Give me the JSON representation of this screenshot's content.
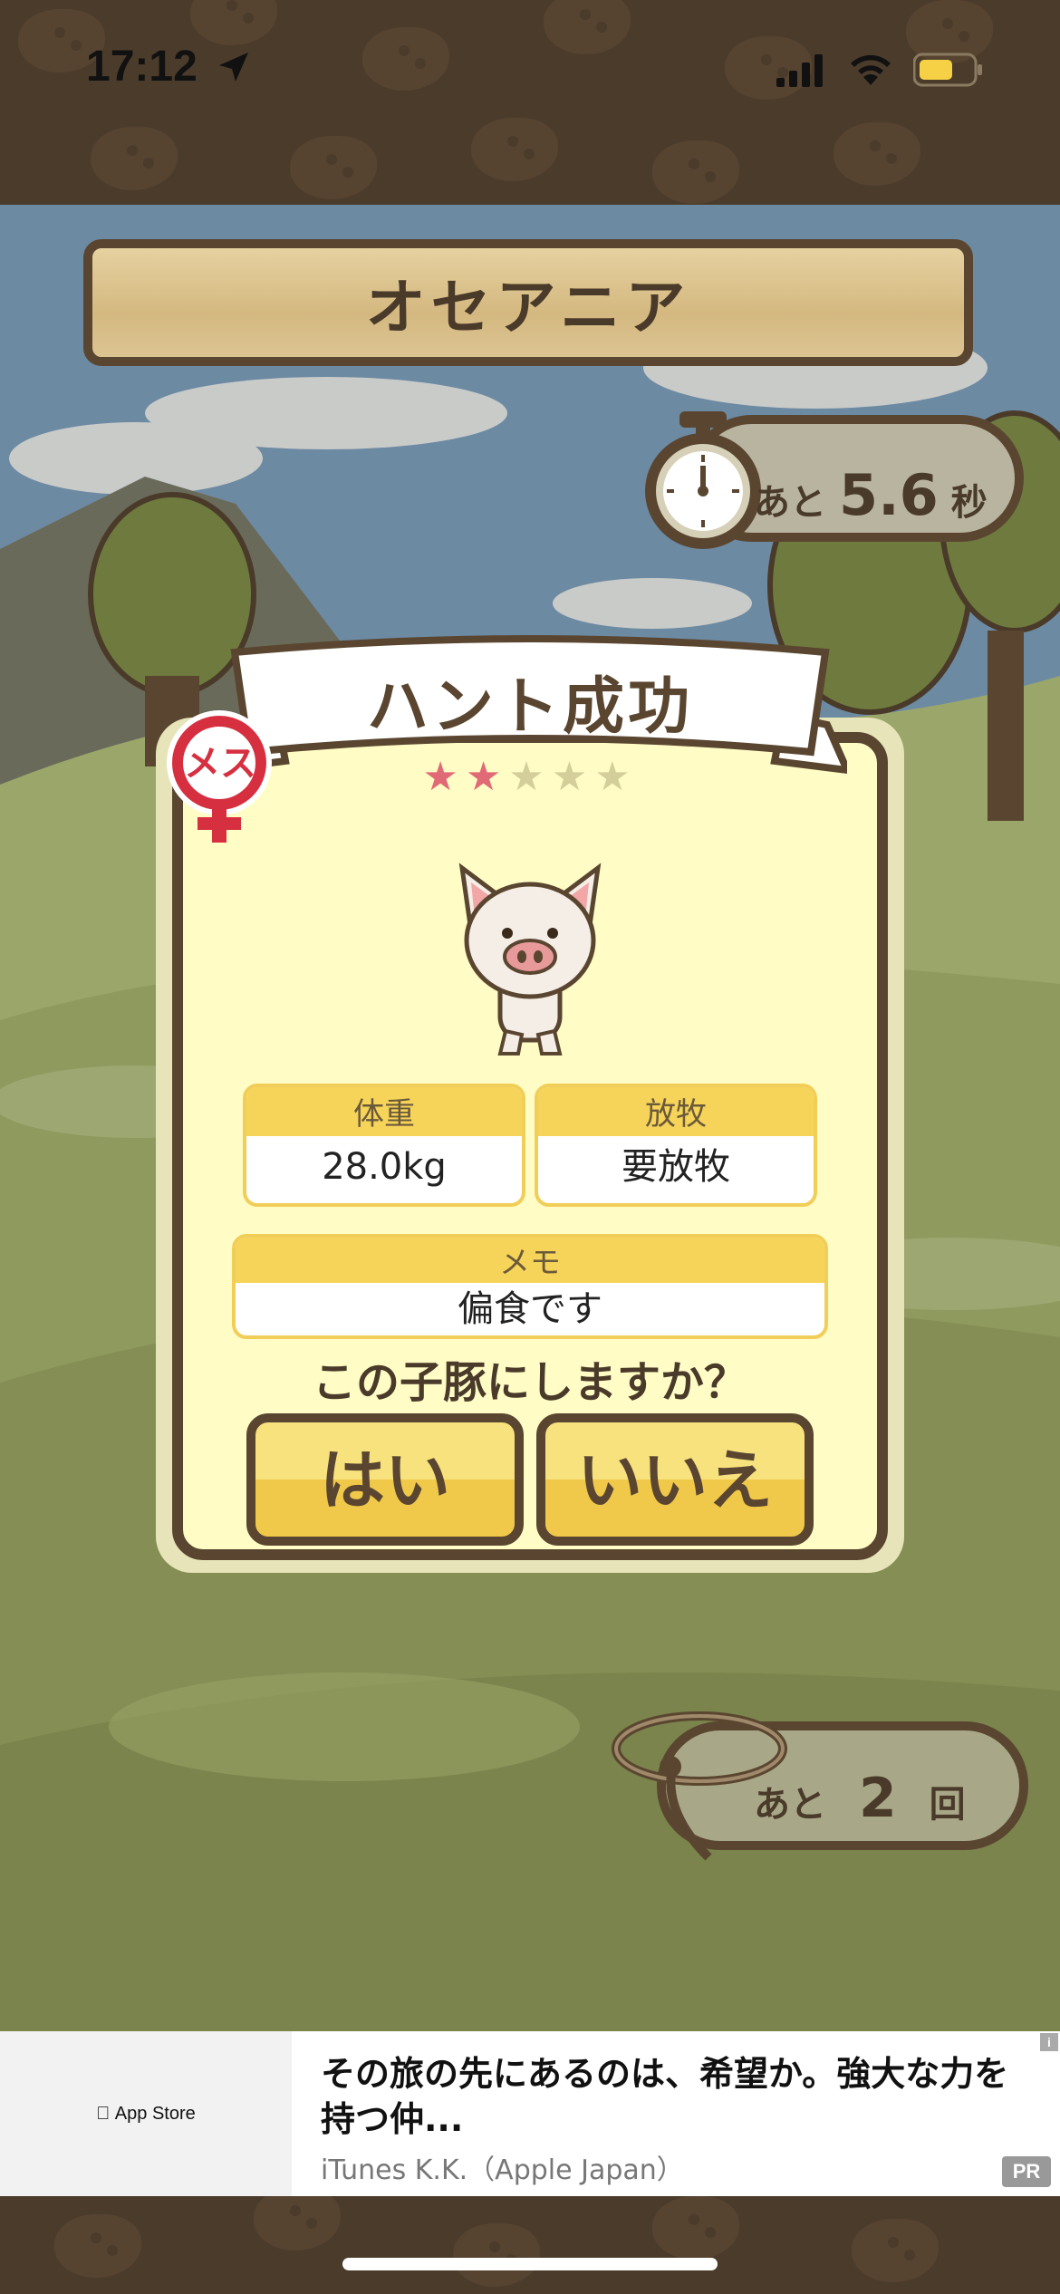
{
  "status_bar": {
    "time": "17:12",
    "icons": [
      "location-arrow-icon",
      "cellular-signal-icon",
      "wifi-icon",
      "battery-icon"
    ],
    "battery_color": "#f6d045"
  },
  "game": {
    "region_title": "オセアニア",
    "timer": {
      "prefix": "あと",
      "value": "5.6",
      "unit": "秒"
    },
    "tries": {
      "prefix": "あと",
      "value": "2",
      "unit": "回"
    }
  },
  "dialog": {
    "title": "ハント成功",
    "gender_label": "メス",
    "rating": {
      "filled": 2,
      "total": 5
    },
    "weight": {
      "label": "体重",
      "value": "28.0kg"
    },
    "pasture": {
      "label": "放牧",
      "value": "要放牧"
    },
    "memo": {
      "label": "メモ",
      "value": "偏食です"
    },
    "question": "この子豚にしますか？",
    "yes_label": "はい",
    "no_label": "いいえ"
  },
  "ad": {
    "store_label": "App Store",
    "headline": "その旅の先にあるのは、希望か。強大な力を持つ仲...",
    "source": "iTunes K.K.（Apple Japan）",
    "badge": "PR",
    "info": "i"
  },
  "colors": {
    "wood_dark": "#5a4630",
    "card_bg": "#fffcc6",
    "field_head": "#f6d45a",
    "star_on": "#e06a75",
    "female_red": "#d63040"
  }
}
